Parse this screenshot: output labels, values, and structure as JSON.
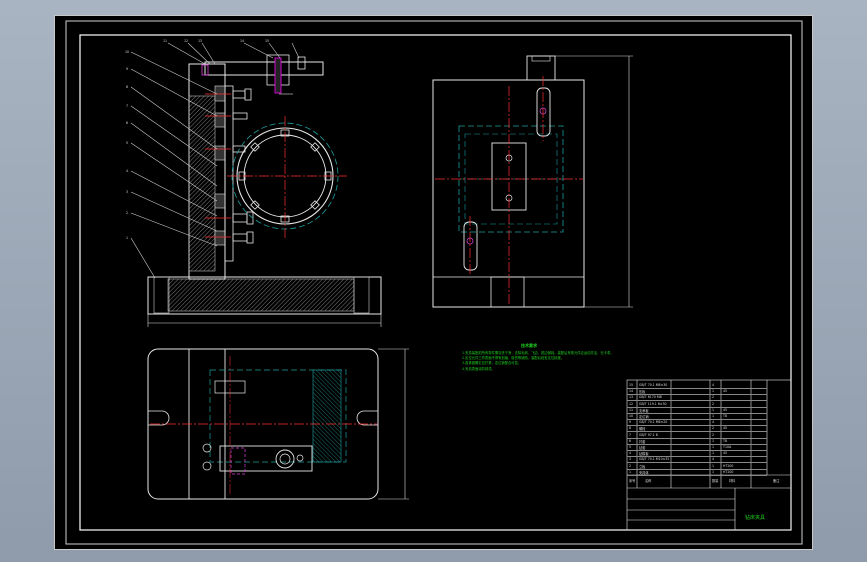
{
  "tech_requirements": {
    "title": "技术要求",
    "lines": [
      "1.夹具装配前所有零件需清洗干净，去除毛刺、飞边、锐边倒钝，装配后夹紧元件应运动灵活、无卡滞。",
      "2.定位元件工作表面不得有划痕、碰伤等缺陷，装配后检查定位精度。",
      "3.各紧固螺钉应拧紧，定位销配合可靠。",
      "4.夹具表面涂防锈漆。"
    ]
  },
  "balloons": [
    "1",
    "2",
    "3",
    "4",
    "5",
    "6",
    "7",
    "8",
    "9",
    "10",
    "11",
    "12",
    "13",
    "14",
    "15"
  ],
  "title_block": {
    "header": {
      "no": "序号",
      "name": "名称",
      "qty": "数量",
      "material": "材料",
      "note": "备注"
    },
    "rows": [
      [
        "15",
        "GB/T 70.1 M8×30",
        "4",
        "",
        ""
      ],
      [
        "14",
        "压板",
        "1",
        "45",
        ""
      ],
      [
        "13",
        "GB/T 6170 M8",
        "2",
        "",
        ""
      ],
      [
        "12",
        "GB/T 119.1 6×30",
        "2",
        "",
        ""
      ],
      [
        "11",
        "支承板",
        "1",
        "45",
        ""
      ],
      [
        "10",
        "定位销",
        "1",
        "T8",
        ""
      ],
      [
        "9",
        "GB/T 70.1 M6×20",
        "4",
        "",
        ""
      ],
      [
        "8",
        "螺栓",
        "2",
        "45",
        ""
      ],
      [
        "7",
        "GB/T 97.1 8",
        "2",
        "",
        ""
      ],
      [
        "6",
        "衬套",
        "1",
        "T8",
        ""
      ],
      [
        "5",
        "钻套",
        "1",
        "T10A",
        ""
      ],
      [
        "4",
        "钻模板",
        "1",
        "45",
        ""
      ],
      [
        "3",
        "GB/T 70.1 M10×35",
        "4",
        "",
        ""
      ],
      [
        "2",
        "立板",
        "1",
        "HT200",
        ""
      ],
      [
        "1",
        "夹具体",
        "1",
        "HT200",
        ""
      ]
    ],
    "drawing_name": "钻床夹具"
  }
}
